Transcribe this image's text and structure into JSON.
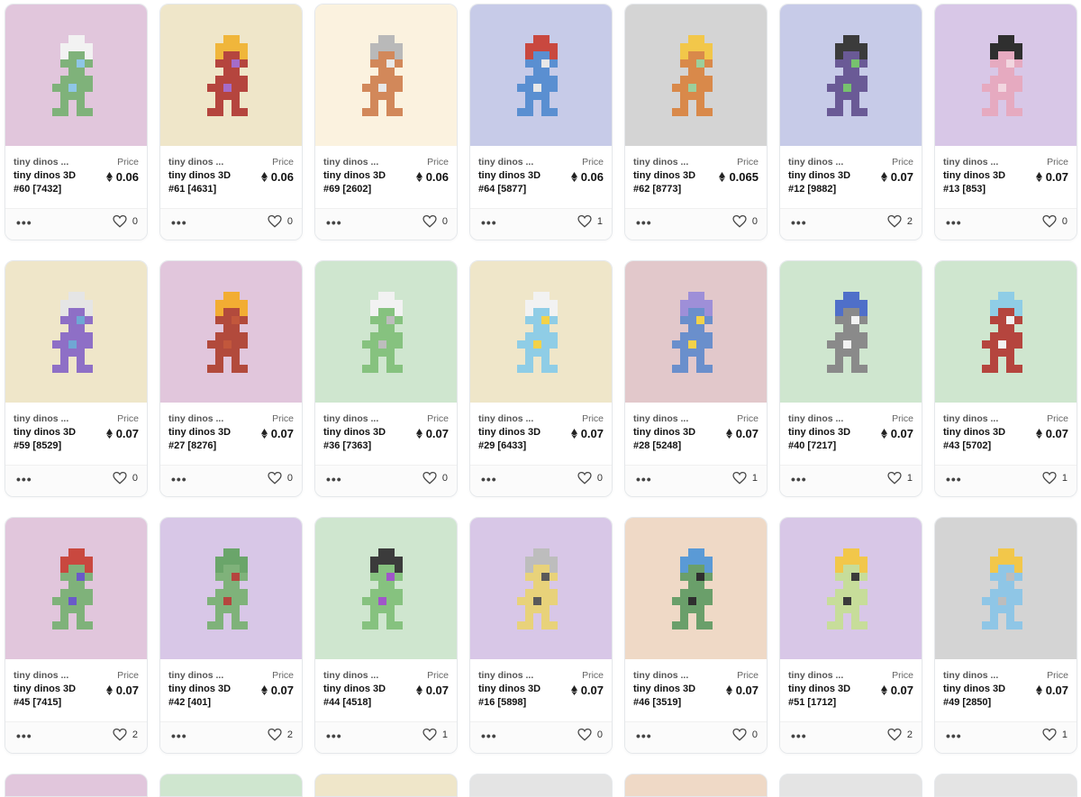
{
  "labels": {
    "price": "Price",
    "more": "•••"
  },
  "cards": [
    {
      "collection": "tiny dinos ...",
      "name": "tiny dinos 3D #60 [7432]",
      "price": "0.06",
      "likes": "0",
      "bg": "#e1c6dc",
      "c1": "#7fb27a",
      "c2": "#f2f2f2",
      "c3": "#8ec6e6"
    },
    {
      "collection": "tiny dinos ...",
      "name": "tiny dinos 3D #61 [4631]",
      "price": "0.06",
      "likes": "0",
      "bg": "#efe6c9",
      "c1": "#b5453e",
      "c2": "#f0b63b",
      "c3": "#a56cc9"
    },
    {
      "collection": "tiny dinos ...",
      "name": "tiny dinos 3D #69 [2602]",
      "price": "0.06",
      "likes": "0",
      "bg": "#fbf2df",
      "c1": "#d2885a",
      "c2": "#b9b9b9",
      "c3": "#e8e8e8"
    },
    {
      "collection": "tiny dinos ...",
      "name": "tiny dinos 3D #64 [5877]",
      "price": "0.06",
      "likes": "1",
      "bg": "#c7cbe8",
      "c1": "#5a8fd1",
      "c2": "#c9483f",
      "c3": "#e8e8e8"
    },
    {
      "collection": "tiny dinos ...",
      "name": "tiny dinos 3D #62 [8773]",
      "price": "0.065",
      "likes": "0",
      "bg": "#d4d4d4",
      "c1": "#d9894a",
      "c2": "#f2c74a",
      "c3": "#9ccf9c"
    },
    {
      "collection": "tiny dinos ...",
      "name": "tiny dinos 3D #12 [9882]",
      "price": "0.07",
      "likes": "2",
      "bg": "#c7cbe8",
      "c1": "#6a5a96",
      "c2": "#3b3b3b",
      "c3": "#77c26e"
    },
    {
      "collection": "tiny dinos ...",
      "name": "tiny dinos 3D #13 [853]",
      "price": "0.07",
      "likes": "0",
      "bg": "#d8c7e7",
      "c1": "#e6aac0",
      "c2": "#2f2f2f",
      "c3": "#f2d6e0"
    },
    {
      "collection": "tiny dinos ...",
      "name": "tiny dinos 3D #59 [8529]",
      "price": "0.07",
      "likes": "0",
      "bg": "#efe6c9",
      "c1": "#8e6fc6",
      "c2": "#e5e5e5",
      "c3": "#6fa7d4"
    },
    {
      "collection": "tiny dinos ...",
      "name": "tiny dinos 3D #27 [8276]",
      "price": "0.07",
      "likes": "0",
      "bg": "#e1c6dc",
      "c1": "#b24a3c",
      "c2": "#f2ad33",
      "c3": "#c2573c"
    },
    {
      "collection": "tiny dinos ...",
      "name": "tiny dinos 3D #36 [7363]",
      "price": "0.07",
      "likes": "0",
      "bg": "#cfe6cf",
      "c1": "#86c27f",
      "c2": "#f2f2f2",
      "c3": "#bdbdbd"
    },
    {
      "collection": "tiny dinos ...",
      "name": "tiny dinos 3D #29 [6433]",
      "price": "0.07",
      "likes": "0",
      "bg": "#efe6c9",
      "c1": "#8fcde6",
      "c2": "#f2f2f2",
      "c3": "#f2d24a"
    },
    {
      "collection": "tiny dinos ...",
      "name": "tiny dinos 3D #28 [5248]",
      "price": "0.07",
      "likes": "1",
      "bg": "#e2c8cb",
      "c1": "#6a8fcc",
      "c2": "#9e8fd8",
      "c3": "#f2d24a"
    },
    {
      "collection": "tiny dinos ...",
      "name": "tiny dinos 3D #40 [7217]",
      "price": "0.07",
      "likes": "1",
      "bg": "#cfe6cf",
      "c1": "#8a8a8a",
      "c2": "#4f6fc9",
      "c3": "#f2f2f2"
    },
    {
      "collection": "tiny dinos ...",
      "name": "tiny dinos 3D #43 [5702]",
      "price": "0.07",
      "likes": "1",
      "bg": "#cfe6cf",
      "c1": "#b5453e",
      "c2": "#8fcde6",
      "c3": "#f2f2f2"
    },
    {
      "collection": "tiny dinos ...",
      "name": "tiny dinos 3D #45 [7415]",
      "price": "0.07",
      "likes": "2",
      "bg": "#e1c6dc",
      "c1": "#7fb27a",
      "c2": "#c9483f",
      "c3": "#6a5ac9"
    },
    {
      "collection": "tiny dinos ...",
      "name": "tiny dinos 3D #42 [401]",
      "price": "0.07",
      "likes": "2",
      "bg": "#d8c7e7",
      "c1": "#7fb27a",
      "c2": "#6aa56a",
      "c3": "#b5453e"
    },
    {
      "collection": "tiny dinos ...",
      "name": "tiny dinos 3D #44 [4518]",
      "price": "0.07",
      "likes": "1",
      "bg": "#cfe6cf",
      "c1": "#86c27f",
      "c2": "#3b3b3b",
      "c3": "#a056c9"
    },
    {
      "collection": "tiny dinos ...",
      "name": "tiny dinos 3D #16 [5898]",
      "price": "0.07",
      "likes": "0",
      "bg": "#d8c7e7",
      "c1": "#e8d27a",
      "c2": "#bdbdbd",
      "c3": "#5a5a5a"
    },
    {
      "collection": "tiny dinos ...",
      "name": "tiny dinos 3D #46 [3519]",
      "price": "0.07",
      "likes": "0",
      "bg": "#efd9c6",
      "c1": "#6a9f6a",
      "c2": "#5a9ad6",
      "c3": "#2f2f2f"
    },
    {
      "collection": "tiny dinos ...",
      "name": "tiny dinos 3D #51 [1712]",
      "price": "0.07",
      "likes": "2",
      "bg": "#d8c7e7",
      "c1": "#c7dd9a",
      "c2": "#f2c74a",
      "c3": "#3b3b3b"
    },
    {
      "collection": "tiny dinos ...",
      "name": "tiny dinos 3D #49 [2850]",
      "price": "0.07",
      "likes": "1",
      "bg": "#d4d4d4",
      "c1": "#8fc6e6",
      "c2": "#f2c74a",
      "c3": "#bdbdbd"
    }
  ],
  "partial_row": [
    {
      "bg": "#e1c6dc"
    },
    {
      "bg": "#cfe6cf"
    },
    {
      "bg": "#efe6c9"
    },
    {
      "bg": "#e4e4e4"
    },
    {
      "bg": "#efd9c6"
    },
    {
      "bg": "#e4e4e4"
    },
    {
      "bg": "#e4e4e4"
    }
  ]
}
